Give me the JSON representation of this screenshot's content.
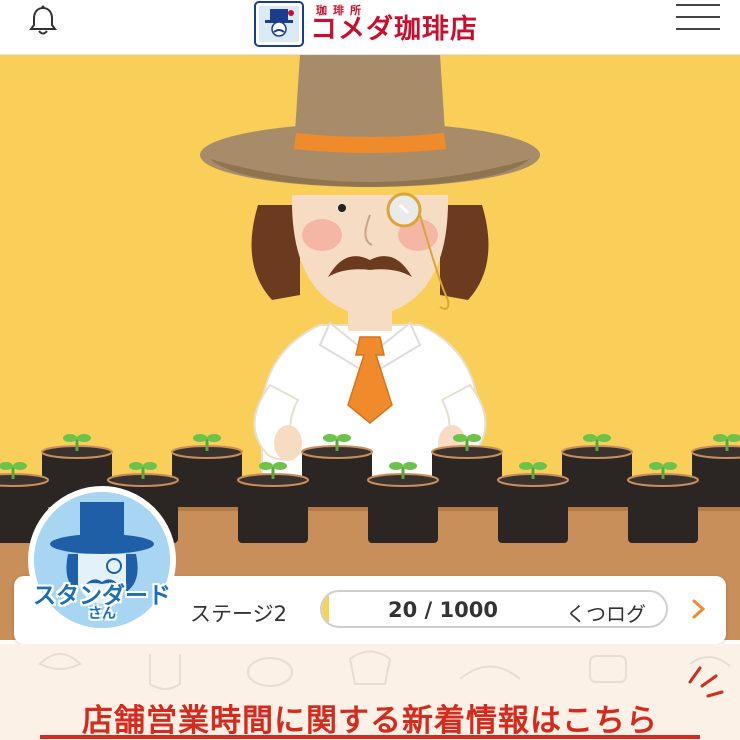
{
  "header": {
    "logo_small": "珈琲所",
    "logo_main": "コメダ珈琲店",
    "icons": {
      "notification": "bell-icon",
      "menu": "hamburger-menu-icon"
    }
  },
  "scene": {
    "description_icon": "komeda-character-illustration",
    "colors": {
      "background": "#f9cf5a",
      "shelf": "#c98f5a",
      "hat": "#a88c69",
      "hatband": "#f08b2b",
      "tie": "#f08b2b"
    }
  },
  "status": {
    "rank": "スタンダード",
    "rank_suffix": "さん",
    "stage": "ステージ2",
    "progress_count": "20 / 1000",
    "progress_value": 20,
    "progress_max": 1000,
    "log_link": "くつログ"
  },
  "banner": {
    "text": "店舗営業時間に関する新着情報はこちら"
  },
  "colors": {
    "accent_red": "#d52b1e",
    "rank_blue": "#1a6fb5"
  }
}
